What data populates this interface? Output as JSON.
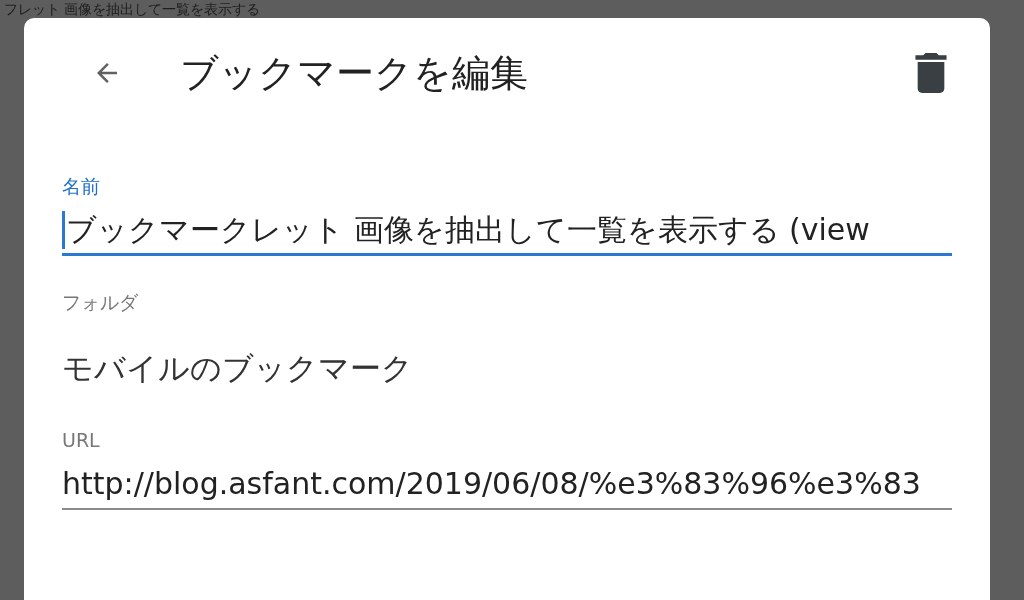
{
  "background": {
    "title": "フレット 画像を抽出して一覧を表示する"
  },
  "dialog": {
    "title": "ブックマークを編集",
    "fields": [
      {
        "kind": "input",
        "label": "名前",
        "value": "ブックマークレット 画像を抽出して一覧を表示する (view",
        "focused": true
      },
      {
        "kind": "static",
        "label": "フォルダ",
        "value": "モバイルのブックマーク",
        "focused": false
      },
      {
        "kind": "input",
        "label": "URL",
        "value": "http://blog.asfant.com/2019/06/08/%e3%83%96%e3%83",
        "focused": false
      }
    ]
  }
}
